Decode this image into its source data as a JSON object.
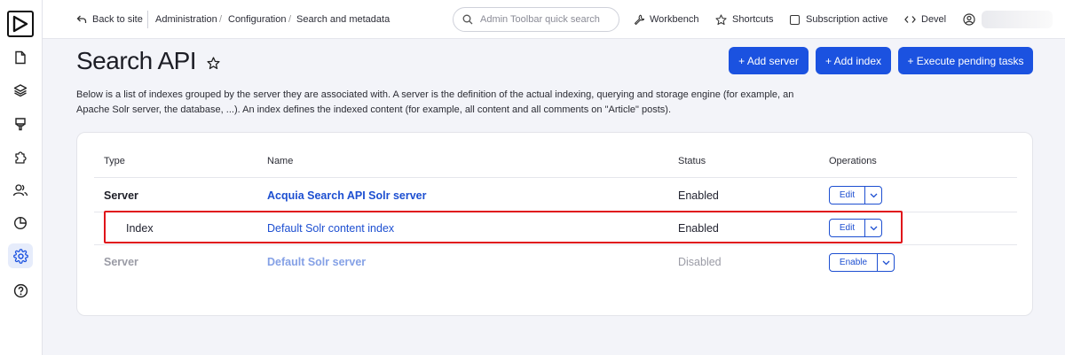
{
  "topbar": {
    "back_label": "Back to site",
    "breadcrumbs": [
      "Administration",
      "Configuration",
      "Search and metadata"
    ],
    "search_placeholder": "Admin Toolbar quick search",
    "workbench": "Workbench",
    "shortcuts": "Shortcuts",
    "subscription": "Subscription active",
    "devel": "Devel"
  },
  "page": {
    "title": "Search API",
    "buttons": {
      "add_server": "+ Add server",
      "add_index": "+ Add index",
      "execute_tasks": "+ Execute pending tasks"
    },
    "description": "Below is a list of indexes grouped by the server they are associated with. A server is the definition of the actual indexing, querying and storage engine (for example, an Apache Solr server, the database, ...). An index defines the indexed content (for example, all content and all comments on \"Article\" posts)."
  },
  "table": {
    "headers": {
      "type": "Type",
      "name": "Name",
      "status": "Status",
      "operations": "Operations"
    },
    "rows": [
      {
        "type": "Server",
        "name": "Acquia Search API Solr server",
        "status": "Enabled",
        "operation": "Edit"
      },
      {
        "type": "Index",
        "name": "Default Solr content index",
        "status": "Enabled",
        "operation": "Edit"
      },
      {
        "type": "Server",
        "name": "Default Solr server",
        "status": "Disabled",
        "operation": "Enable"
      }
    ]
  },
  "colors": {
    "primary": "#1b52e0",
    "link": "#1d4fd1",
    "highlight": "#e0131a",
    "disabled_text": "#9a9ba5"
  },
  "icons": {
    "sidebar": [
      "logo-icon",
      "file-icon",
      "layers-icon",
      "brush-icon",
      "puzzle-icon",
      "people-icon",
      "pie-chart-icon",
      "gear-icon",
      "help-icon"
    ],
    "topbar": [
      "back-arrow-icon",
      "search-icon",
      "wrench-icon",
      "star-icon",
      "checkbox-icon",
      "code-icon",
      "user-icon"
    ]
  }
}
